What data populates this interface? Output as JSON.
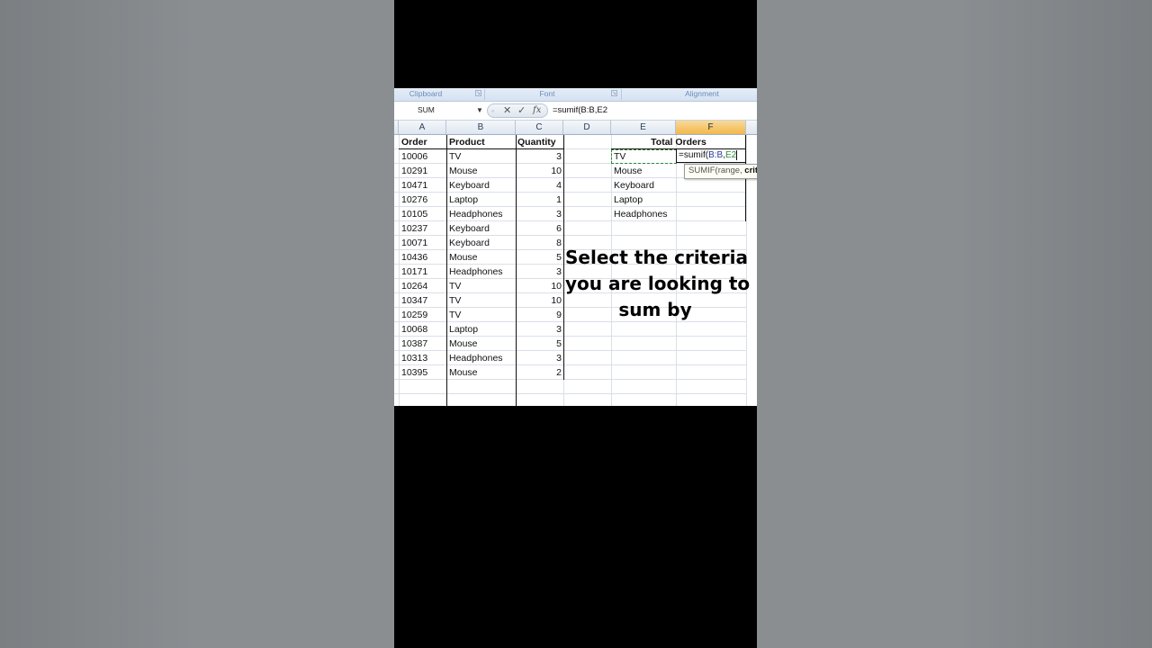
{
  "ribbon": {
    "groups": [
      "Clipboard",
      "Font",
      "Alignment"
    ]
  },
  "formula_bar": {
    "name_box": "SUM",
    "cancel": "✕",
    "enter": "✓",
    "fx": "fx",
    "formula": "=sumif(B:B,E2"
  },
  "columns": [
    "A",
    "B",
    "C",
    "D",
    "E",
    "F"
  ],
  "active_column": "F",
  "table": {
    "headers": {
      "order": "Order",
      "product": "Product",
      "quantity": "Quantity"
    },
    "rows": [
      {
        "order": "10006",
        "product": "TV",
        "quantity": "3"
      },
      {
        "order": "10291",
        "product": "Mouse",
        "quantity": "10"
      },
      {
        "order": "10471",
        "product": "Keyboard",
        "quantity": "4"
      },
      {
        "order": "10276",
        "product": "Laptop",
        "quantity": "1"
      },
      {
        "order": "10105",
        "product": "Headphones",
        "quantity": "3"
      },
      {
        "order": "10237",
        "product": "Keyboard",
        "quantity": "6"
      },
      {
        "order": "10071",
        "product": "Keyboard",
        "quantity": "8"
      },
      {
        "order": "10436",
        "product": "Mouse",
        "quantity": "5"
      },
      {
        "order": "10171",
        "product": "Headphones",
        "quantity": "3"
      },
      {
        "order": "10264",
        "product": "TV",
        "quantity": "10"
      },
      {
        "order": "10347",
        "product": "TV",
        "quantity": "10"
      },
      {
        "order": "10259",
        "product": "TV",
        "quantity": "9"
      },
      {
        "order": "10068",
        "product": "Laptop",
        "quantity": "3"
      },
      {
        "order": "10387",
        "product": "Mouse",
        "quantity": "5"
      },
      {
        "order": "10313",
        "product": "Headphones",
        "quantity": "3"
      },
      {
        "order": "10395",
        "product": "Mouse",
        "quantity": "2"
      }
    ]
  },
  "summary": {
    "title": "Total Orders",
    "items": [
      "TV",
      "Mouse",
      "Keyboard",
      "Laptop",
      "Headphones"
    ],
    "edit_cell": {
      "prefix": "=sumif(",
      "range": "B:B",
      "sep": ",",
      "ref": "E2"
    }
  },
  "tooltip": {
    "func": "SUMIF(range, ",
    "arg": "crit"
  },
  "overlay": {
    "lines": [
      "Select the criteria",
      "you are looking to",
      "sum by"
    ]
  },
  "colors": {
    "range_ref": "#2a3a9a",
    "cell_ref": "#2e8b3a",
    "active_header": "#f2b84b"
  }
}
